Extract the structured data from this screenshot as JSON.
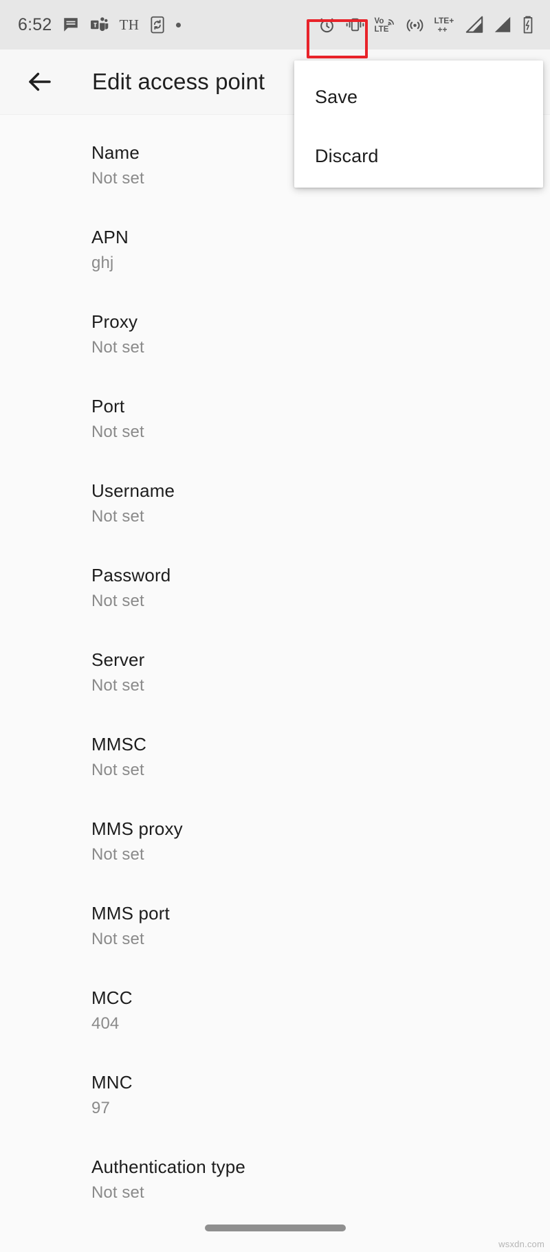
{
  "status_bar": {
    "time": "6:52",
    "left_icons": [
      {
        "name": "messages-icon",
        "label": "messages"
      },
      {
        "name": "teams-icon",
        "label": "teams"
      },
      {
        "name": "th-text-icon",
        "label": "TH"
      },
      {
        "name": "sync-phone-icon",
        "label": "device-sync"
      },
      {
        "name": "dot-icon",
        "label": "notification-dot"
      }
    ],
    "right_icons": [
      {
        "name": "alarm-icon",
        "label": "alarm"
      },
      {
        "name": "vibrate-icon",
        "label": "vibrate"
      },
      {
        "name": "volte-icon",
        "label": "VoLTE"
      },
      {
        "name": "hotspot-icon",
        "label": "hotspot"
      },
      {
        "name": "lte-plus-icon",
        "label": "LTE+"
      },
      {
        "name": "signal-one-icon",
        "label": "signal-sim1"
      },
      {
        "name": "signal-two-icon",
        "label": "signal-sim2"
      },
      {
        "name": "battery-charging-icon",
        "label": "battery"
      }
    ],
    "volte_top": "Vo",
    "volte_bottom": "LTE",
    "lte_label": "LTE+",
    "lte_sub": "++",
    "th_label": "TH"
  },
  "app_bar": {
    "back_label": "Back",
    "title": "Edit access point"
  },
  "menu": {
    "items": [
      {
        "label": "Save",
        "highlighted": true
      },
      {
        "label": "Discard",
        "highlighted": false
      }
    ]
  },
  "settings": {
    "items": [
      {
        "title": "Name",
        "value": "Not set"
      },
      {
        "title": "APN",
        "value": "ghj"
      },
      {
        "title": "Proxy",
        "value": "Not set"
      },
      {
        "title": "Port",
        "value": "Not set"
      },
      {
        "title": "Username",
        "value": "Not set"
      },
      {
        "title": "Password",
        "value": "Not set"
      },
      {
        "title": "Server",
        "value": "Not set"
      },
      {
        "title": "MMSC",
        "value": "Not set"
      },
      {
        "title": "MMS proxy",
        "value": "Not set"
      },
      {
        "title": "MMS port",
        "value": "Not set"
      },
      {
        "title": "MCC",
        "value": "404"
      },
      {
        "title": "MNC",
        "value": "97"
      },
      {
        "title": "Authentication type",
        "value": "Not set"
      }
    ]
  },
  "nav_bar": {
    "home_handle": "home-gesture-handle"
  },
  "watermark": {
    "text": "wsxdn.com"
  },
  "colors": {
    "status_bar_bg": "#e7e7e7",
    "app_bar_bg": "#f7f7f7",
    "page_bg": "#fafafa",
    "primary_text": "#1d1d1d",
    "secondary_text": "#8a8a8a",
    "highlight": "#e8232a",
    "menu_bg": "#ffffff"
  }
}
